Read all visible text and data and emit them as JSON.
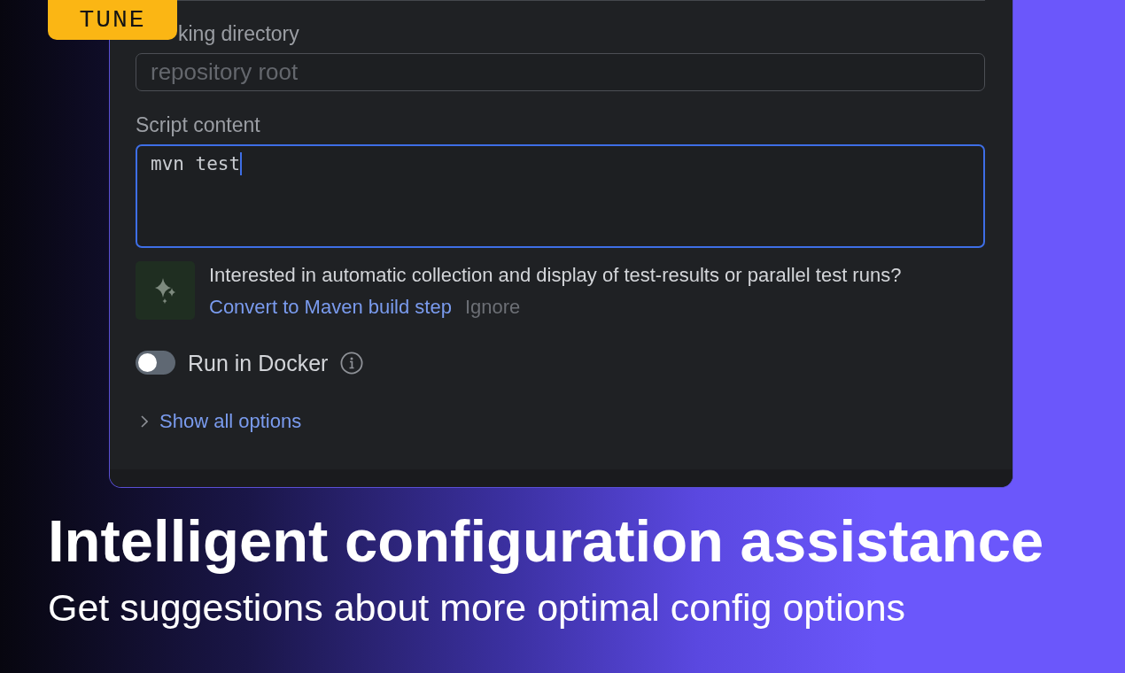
{
  "badge": {
    "label": "TUNE"
  },
  "form": {
    "fields": [
      {
        "kind": "input",
        "label": "king directory",
        "placeholder": "repository root"
      },
      {
        "kind": "textarea",
        "label": "Script content",
        "value": "mvn test",
        "focused": true
      }
    ],
    "suggestion": {
      "text": "Interested in automatic collection and display of test-results or parallel test runs?",
      "actions": [
        {
          "kind": "link",
          "label": "Convert to Maven build step"
        },
        {
          "kind": "dismiss",
          "label": "Ignore"
        }
      ]
    },
    "toggle": {
      "label": "Run in Docker",
      "on": false
    },
    "disclosure": {
      "label": "Show all options",
      "expanded": false
    }
  },
  "headline": {
    "title": "Intelligent configuration assistance",
    "subtitle": "Get suggestions about more optimal config options"
  }
}
